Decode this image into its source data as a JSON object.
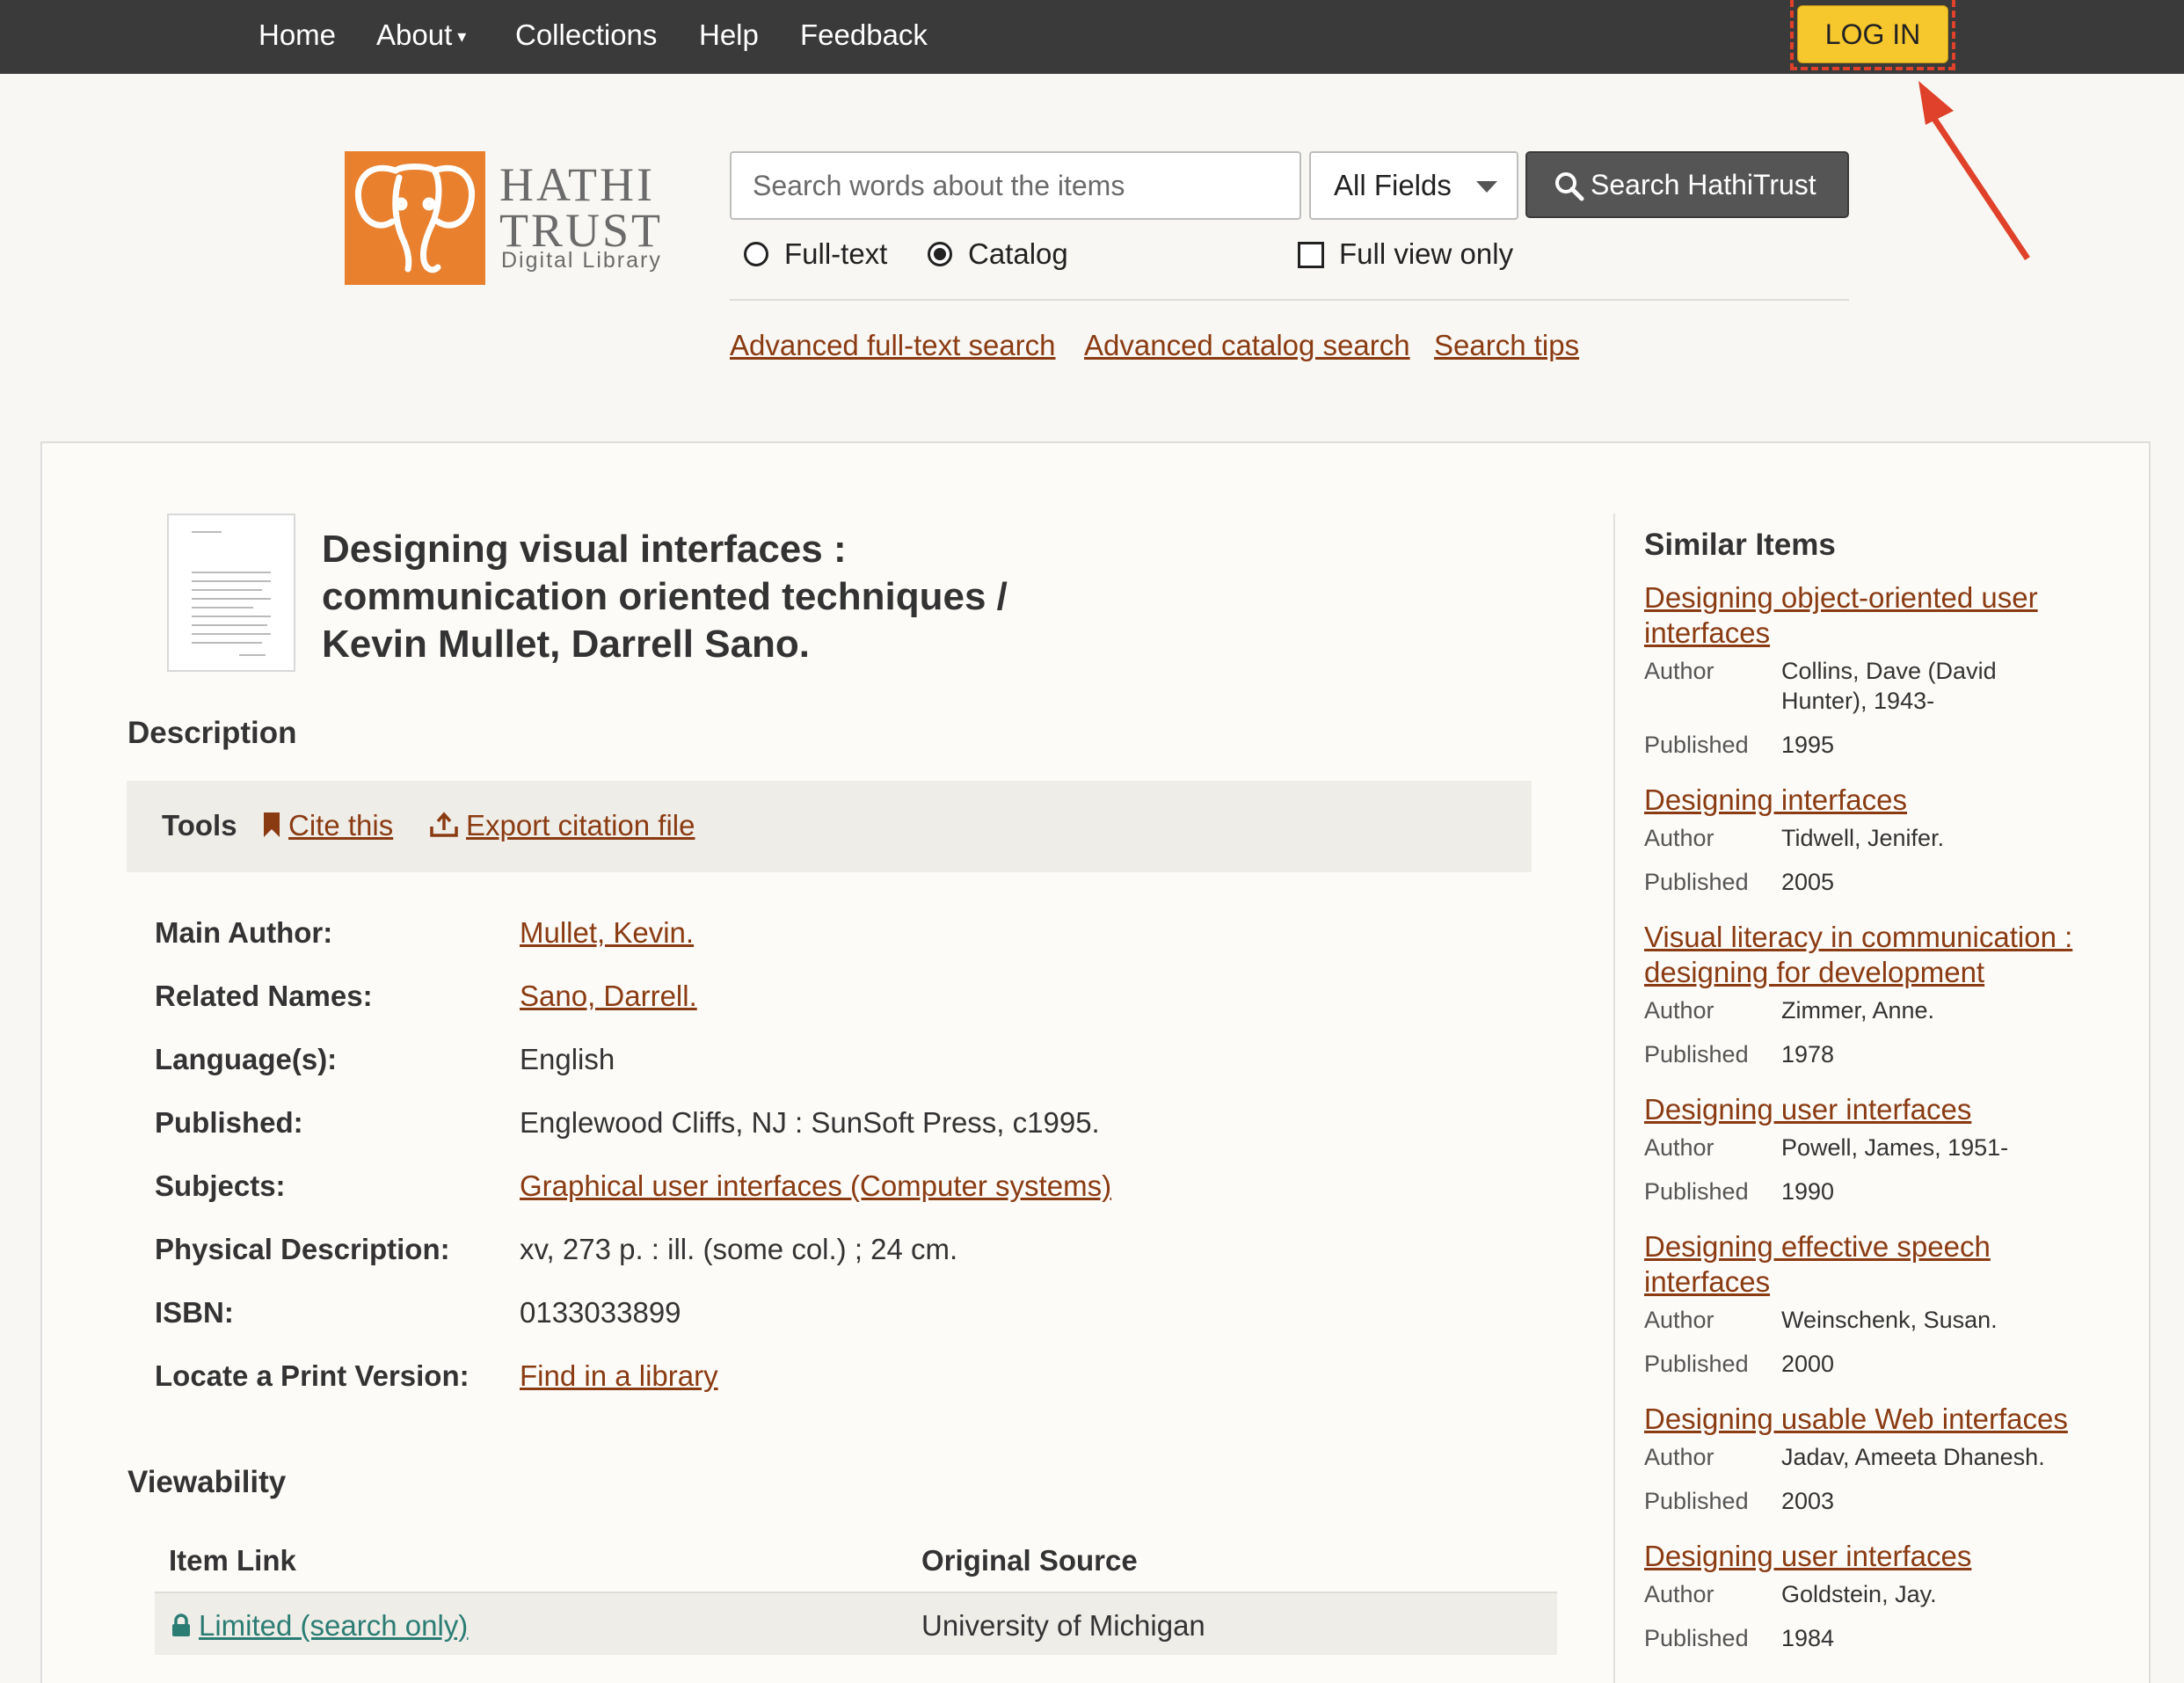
{
  "nav": {
    "items": [
      {
        "label": "Home"
      },
      {
        "label": "About",
        "has_dropdown": true
      },
      {
        "label": "Collections"
      },
      {
        "label": "Help"
      },
      {
        "label": "Feedback"
      }
    ],
    "login_label": "LOG IN"
  },
  "logo": {
    "line1": "HATHI",
    "line2": "TRUST",
    "line3": "Digital Library"
  },
  "search": {
    "placeholder": "Search words about the items",
    "field": "All Fields",
    "button_label": "Search HathiTrust",
    "scope_options": [
      {
        "label": "Full-text",
        "selected": false
      },
      {
        "label": "Catalog",
        "selected": true
      }
    ],
    "full_view_only_label": "Full view only",
    "full_view_only_checked": false,
    "links": [
      "Advanced full-text search",
      "Advanced catalog search",
      "Search tips"
    ]
  },
  "record": {
    "title": "Designing visual interfaces : communication oriented techniques / Kevin Mullet, Darrell Sano.",
    "description_heading": "Description",
    "tools_label": "Tools",
    "tools": [
      "Cite this",
      "Export citation file"
    ],
    "details": [
      {
        "label": "Main Author:",
        "value": "Mullet, Kevin.",
        "link": true
      },
      {
        "label": "Related Names:",
        "value": "Sano, Darrell.",
        "link": true
      },
      {
        "label": "Language(s):",
        "value": "English",
        "link": false
      },
      {
        "label": "Published:",
        "value": "Englewood Cliffs, NJ : SunSoft Press, c1995.",
        "link": false
      },
      {
        "label": "Subjects:",
        "value": "Graphical user interfaces (Computer systems)",
        "link": true
      },
      {
        "label": "Physical Description:",
        "value": "xv, 273 p. : ill. (some col.) ; 24 cm.",
        "link": false
      },
      {
        "label": "ISBN:",
        "value": "0133033899",
        "link": false
      },
      {
        "label": "Locate a Print Version:",
        "value": "Find in a library",
        "link": true
      }
    ],
    "viewability_heading": "Viewability",
    "viewability_table": {
      "headers": [
        "Item Link",
        "Original Source"
      ],
      "rows": [
        {
          "item_link": "Limited (search only)",
          "source": "University of Michigan"
        }
      ]
    }
  },
  "similar": {
    "heading": "Similar Items",
    "author_label": "Author",
    "published_label": "Published",
    "items": [
      {
        "title": "Designing object-oriented user interfaces",
        "author": "Collins, Dave (David Hunter), 1943-",
        "published": "1995"
      },
      {
        "title": "Designing interfaces",
        "author": "Tidwell, Jenifer.",
        "published": "2005"
      },
      {
        "title": "Visual literacy in communication : designing for development",
        "author": "Zimmer, Anne.",
        "published": "1978"
      },
      {
        "title": "Designing user interfaces",
        "author": "Powell, James, 1951-",
        "published": "1990"
      },
      {
        "title": "Designing effective speech interfaces",
        "author": "Weinschenk, Susan.",
        "published": "2000"
      },
      {
        "title": "Designing usable Web interfaces",
        "author": "Jadav, Ameeta Dhanesh.",
        "published": "2003"
      },
      {
        "title": "Designing user interfaces",
        "author": "Goldstein, Jay.",
        "published": "1984"
      }
    ]
  },
  "colors": {
    "topbar": "#3a3a3a",
    "login_button": "#f7c72e",
    "link": "#8a3b12",
    "logo_orange": "#e8802e",
    "annotation_red": "#e0412a",
    "limited_link": "#2b7d74"
  }
}
